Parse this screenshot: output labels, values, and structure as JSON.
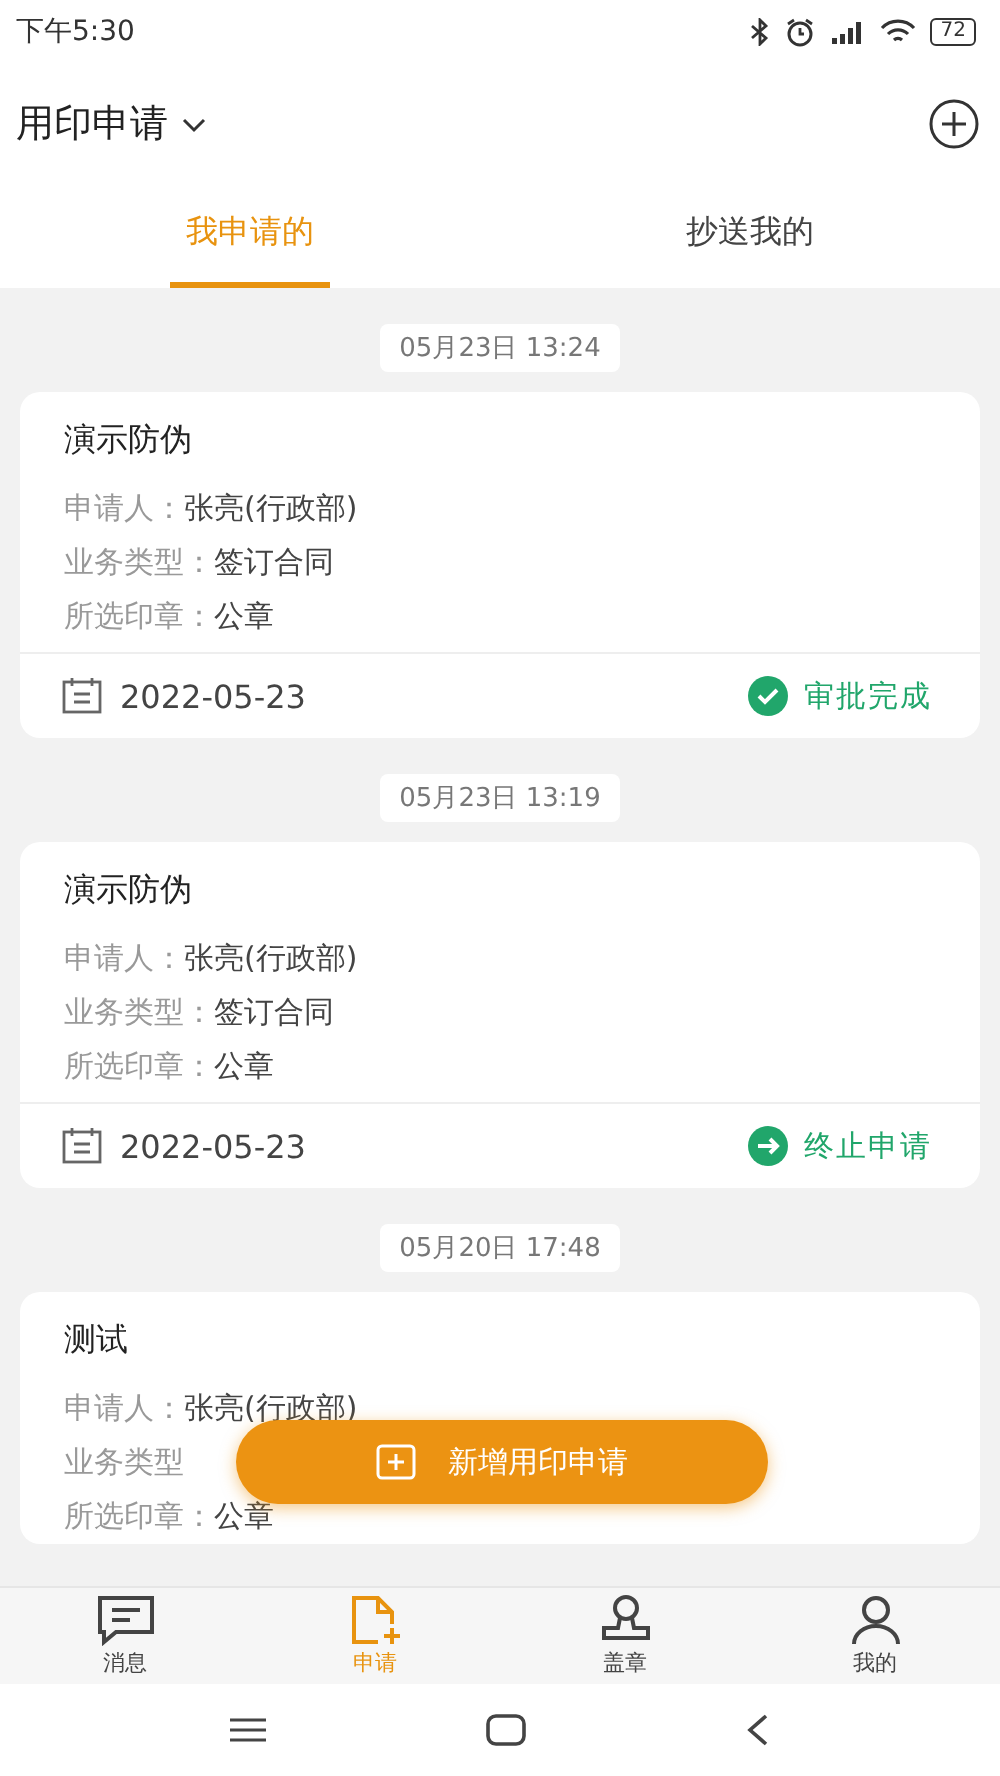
{
  "status_bar": {
    "time": "下午5:30",
    "battery": "72"
  },
  "header": {
    "title": "用印申请"
  },
  "tabs": [
    {
      "label": "我申请的",
      "selected": true
    },
    {
      "label": "抄送我的",
      "selected": false
    }
  ],
  "records": [
    {
      "timestamp": "05月23日 13:24",
      "title": "演示防伪",
      "fields": [
        {
          "label": "申请人：",
          "value": "张亮(行政部)"
        },
        {
          "label": "业务类型：",
          "value": "签订合同"
        },
        {
          "label": "所选印章：",
          "value": "公章"
        }
      ],
      "date": "2022-05-23",
      "status": {
        "kind": "approved",
        "label": "审批完成"
      }
    },
    {
      "timestamp": "05月23日 13:19",
      "title": "演示防伪",
      "fields": [
        {
          "label": "申请人：",
          "value": "张亮(行政部)"
        },
        {
          "label": "业务类型：",
          "value": "签订合同"
        },
        {
          "label": "所选印章：",
          "value": "公章"
        }
      ],
      "date": "2022-05-23",
      "status": {
        "kind": "terminated",
        "label": "终止申请"
      }
    },
    {
      "timestamp": "05月20日 17:48",
      "title": "测试",
      "fields": [
        {
          "label": "申请人：",
          "value": "张亮(行政部)"
        },
        {
          "label": "业务类型"
        },
        {
          "label": "所选印章：",
          "value": "公章"
        }
      ]
    }
  ],
  "fab": {
    "label": "新增用印申请"
  },
  "bottom_nav": [
    {
      "label": "消息",
      "kind": "message",
      "selected": false
    },
    {
      "label": "申请",
      "kind": "apply",
      "selected": true
    },
    {
      "label": "盖章",
      "kind": "stamp",
      "selected": false
    },
    {
      "label": "我的",
      "kind": "profile",
      "selected": false
    }
  ]
}
